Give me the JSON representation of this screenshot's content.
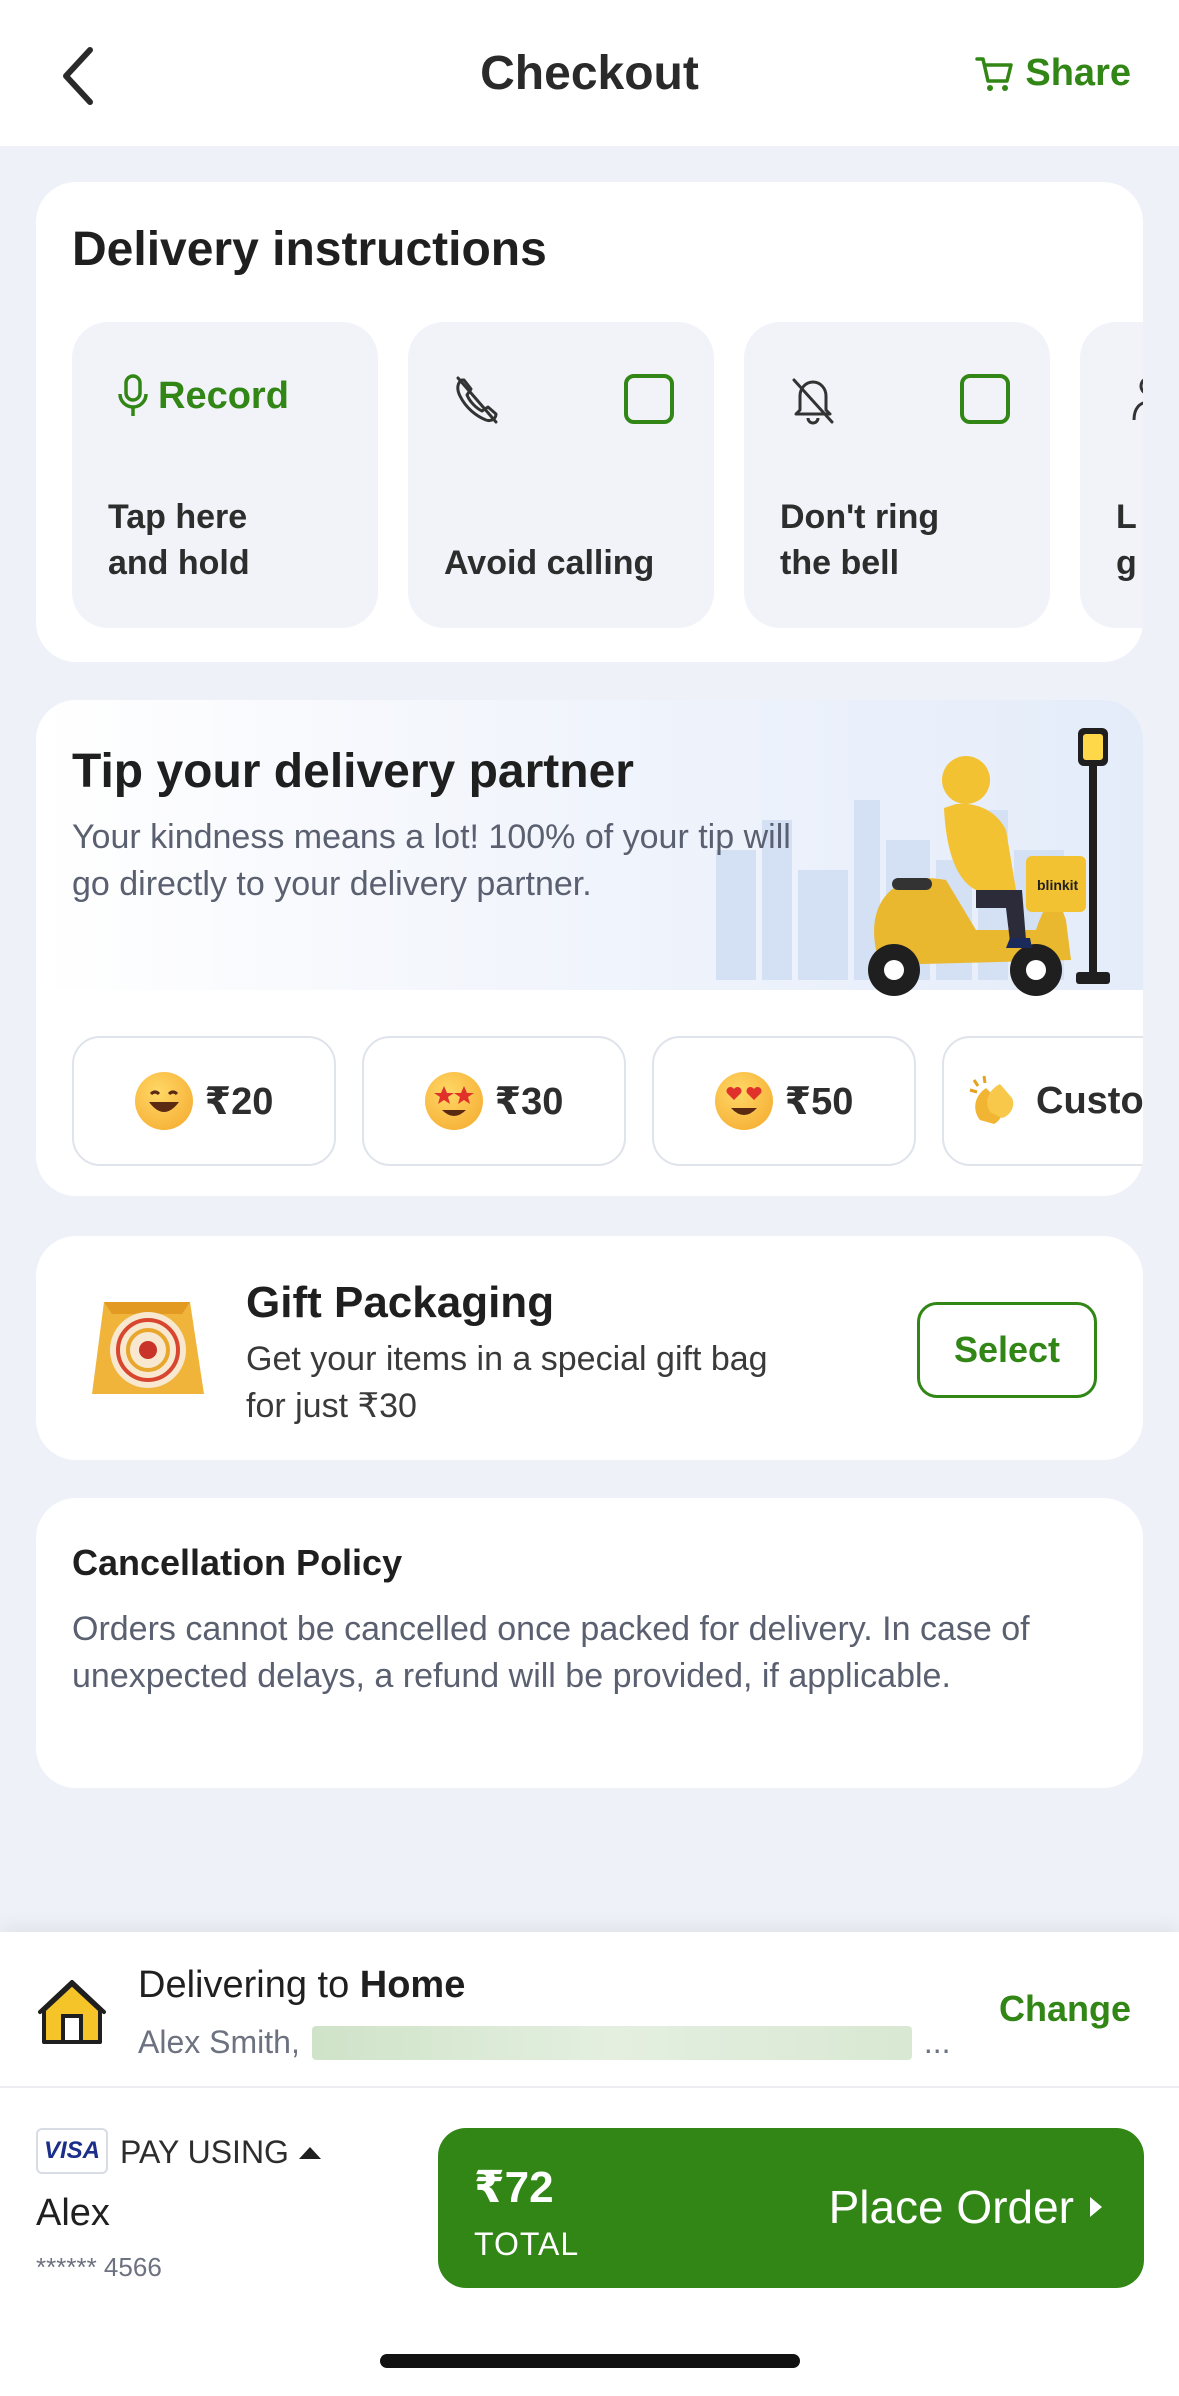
{
  "header": {
    "title": "Checkout",
    "share_label": "Share"
  },
  "delivery_instructions": {
    "title": "Delivery instructions",
    "record": {
      "label": "Record",
      "hint_line1": "Tap here",
      "hint_line2": "and hold"
    },
    "options": [
      {
        "label": "Avoid calling",
        "icon": "phone-off-icon",
        "checked": false
      },
      {
        "label_line1": "Don't ring",
        "label_line2": "the bell",
        "icon": "bell-off-icon",
        "checked": false
      },
      {
        "label_line1": "L",
        "label_line2": "g",
        "icon": "guard-icon",
        "checked": false
      }
    ]
  },
  "tip": {
    "title": "Tip your delivery partner",
    "description": "Your kindness means a lot! 100% of your tip will go directly to your delivery partner.",
    "brand_on_scooter": "blinkit",
    "amounts": [
      "₹20",
      "₹30",
      "₹50"
    ],
    "custom_label": "Custo"
  },
  "gift": {
    "title": "Gift Packaging",
    "description": "Get your items in a special gift bag for just ₹30",
    "button": "Select"
  },
  "cancellation": {
    "title": "Cancellation Policy",
    "text": "Orders cannot be cancelled once packed for delivery. In case of unexpected delays, a refund will be provided, if applicable."
  },
  "address": {
    "prefix": "Delivering to ",
    "place": "Home",
    "name": "Alex Smith,",
    "ellipsis": "...",
    "change": "Change"
  },
  "payment": {
    "card_brand": "VISA",
    "pay_using": "PAY USING",
    "name": "Alex",
    "card_number": "****** 4566"
  },
  "order": {
    "total": "₹72",
    "total_label": "TOTAL",
    "cta": "Place Order"
  },
  "colors": {
    "accent_green": "#318616",
    "background": "#eef1f8"
  }
}
